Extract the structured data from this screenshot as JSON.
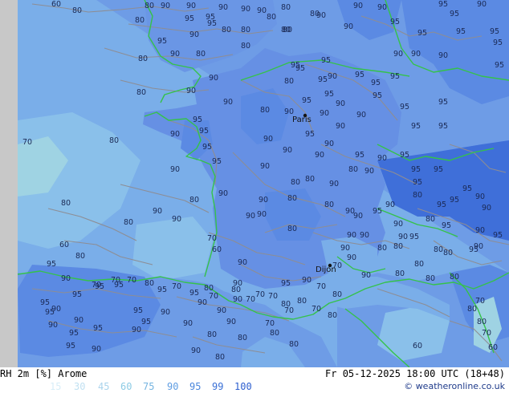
{
  "product": {
    "legend_title": "RH 2m [%] Arome",
    "run_info": "Fr 05-12-2025 18:00 UTC (18+48)",
    "credit_symbol": "©",
    "credit": "weatheronline.co.uk"
  },
  "legend": [
    {
      "value": "15",
      "color": "#d8eef8"
    },
    {
      "value": "30",
      "color": "#c2e1f2"
    },
    {
      "value": "45",
      "color": "#a9d3ec"
    },
    {
      "value": "60",
      "color": "#8ccbe5"
    },
    {
      "value": "75",
      "color": "#75b4e0"
    },
    {
      "value": "90",
      "color": "#5f9de2"
    },
    {
      "value": "95",
      "color": "#4a86dc"
    },
    {
      "value": "99",
      "color": "#3a70d6"
    },
    {
      "value": "100",
      "color": "#2c5ecf"
    }
  ],
  "colors": {
    "sea_rh80": "#7aaee9",
    "land_rh90": "#6e9ce6",
    "land_rh95": "#5b8ae3",
    "humid_rh99": "#3f6fd9",
    "dry_rh60": "#9fd3e3",
    "coastline": "#35c24a",
    "contour": "#8d8d94",
    "no_data": "#c8c8c8"
  },
  "cities": [
    {
      "name": "Paris"
    },
    {
      "name": "Dijon"
    }
  ],
  "contour_labels": [
    "60",
    "80",
    "80",
    "90",
    "90",
    "90",
    "80",
    "80",
    "80",
    "95",
    "90",
    "90",
    "90",
    "90",
    "95",
    "90",
    "95",
    "95",
    "95",
    "80",
    "95",
    "90",
    "80",
    "80",
    "80",
    "90",
    "95",
    "95",
    "95",
    "90",
    "95",
    "90",
    "80",
    "80",
    "80",
    "80",
    "95",
    "90",
    "90",
    "90",
    "95",
    "95",
    "95",
    "80",
    "95",
    "80",
    "90",
    "95",
    "90",
    "95",
    "95",
    "95",
    "90",
    "80",
    "90",
    "95",
    "95",
    "95",
    "90",
    "95",
    "90",
    "90",
    "90",
    "95",
    "70",
    "80",
    "95",
    "90",
    "95",
    "95",
    "95",
    "95",
    "90",
    "90",
    "95",
    "90",
    "95",
    "90",
    "95",
    "90",
    "95",
    "95",
    "90",
    "90",
    "90",
    "80",
    "90",
    "80",
    "90",
    "95",
    "95",
    "80",
    "90",
    "80",
    "90",
    "80",
    "90",
    "80",
    "80",
    "90",
    "90",
    "80",
    "80",
    "90",
    "90",
    "90",
    "80",
    "95",
    "80",
    "95",
    "90",
    "90",
    "90",
    "95",
    "90",
    "90",
    "80",
    "90",
    "90",
    "95",
    "95",
    "95",
    "90",
    "95",
    "70",
    "60",
    "90",
    "80",
    "80",
    "80",
    "90",
    "80",
    "80",
    "60",
    "80",
    "90",
    "70",
    "90",
    "90",
    "80",
    "80",
    "95",
    "95",
    "90",
    "70",
    "70",
    "70",
    "80",
    "70",
    "80",
    "90",
    "95",
    "95",
    "95",
    "95",
    "95",
    "95",
    "70",
    "80",
    "70",
    "70",
    "70",
    "80",
    "90",
    "70",
    "80",
    "95",
    "90",
    "95",
    "90",
    "90",
    "90",
    "90",
    "70",
    "80",
    "70",
    "70",
    "95",
    "90",
    "95",
    "90",
    "90",
    "70",
    "80",
    "80",
    "90",
    "95",
    "95",
    "90",
    "80",
    "80",
    "80",
    "80",
    "70",
    "95",
    "90",
    "90",
    "80",
    "80",
    "60",
    "60"
  ]
}
